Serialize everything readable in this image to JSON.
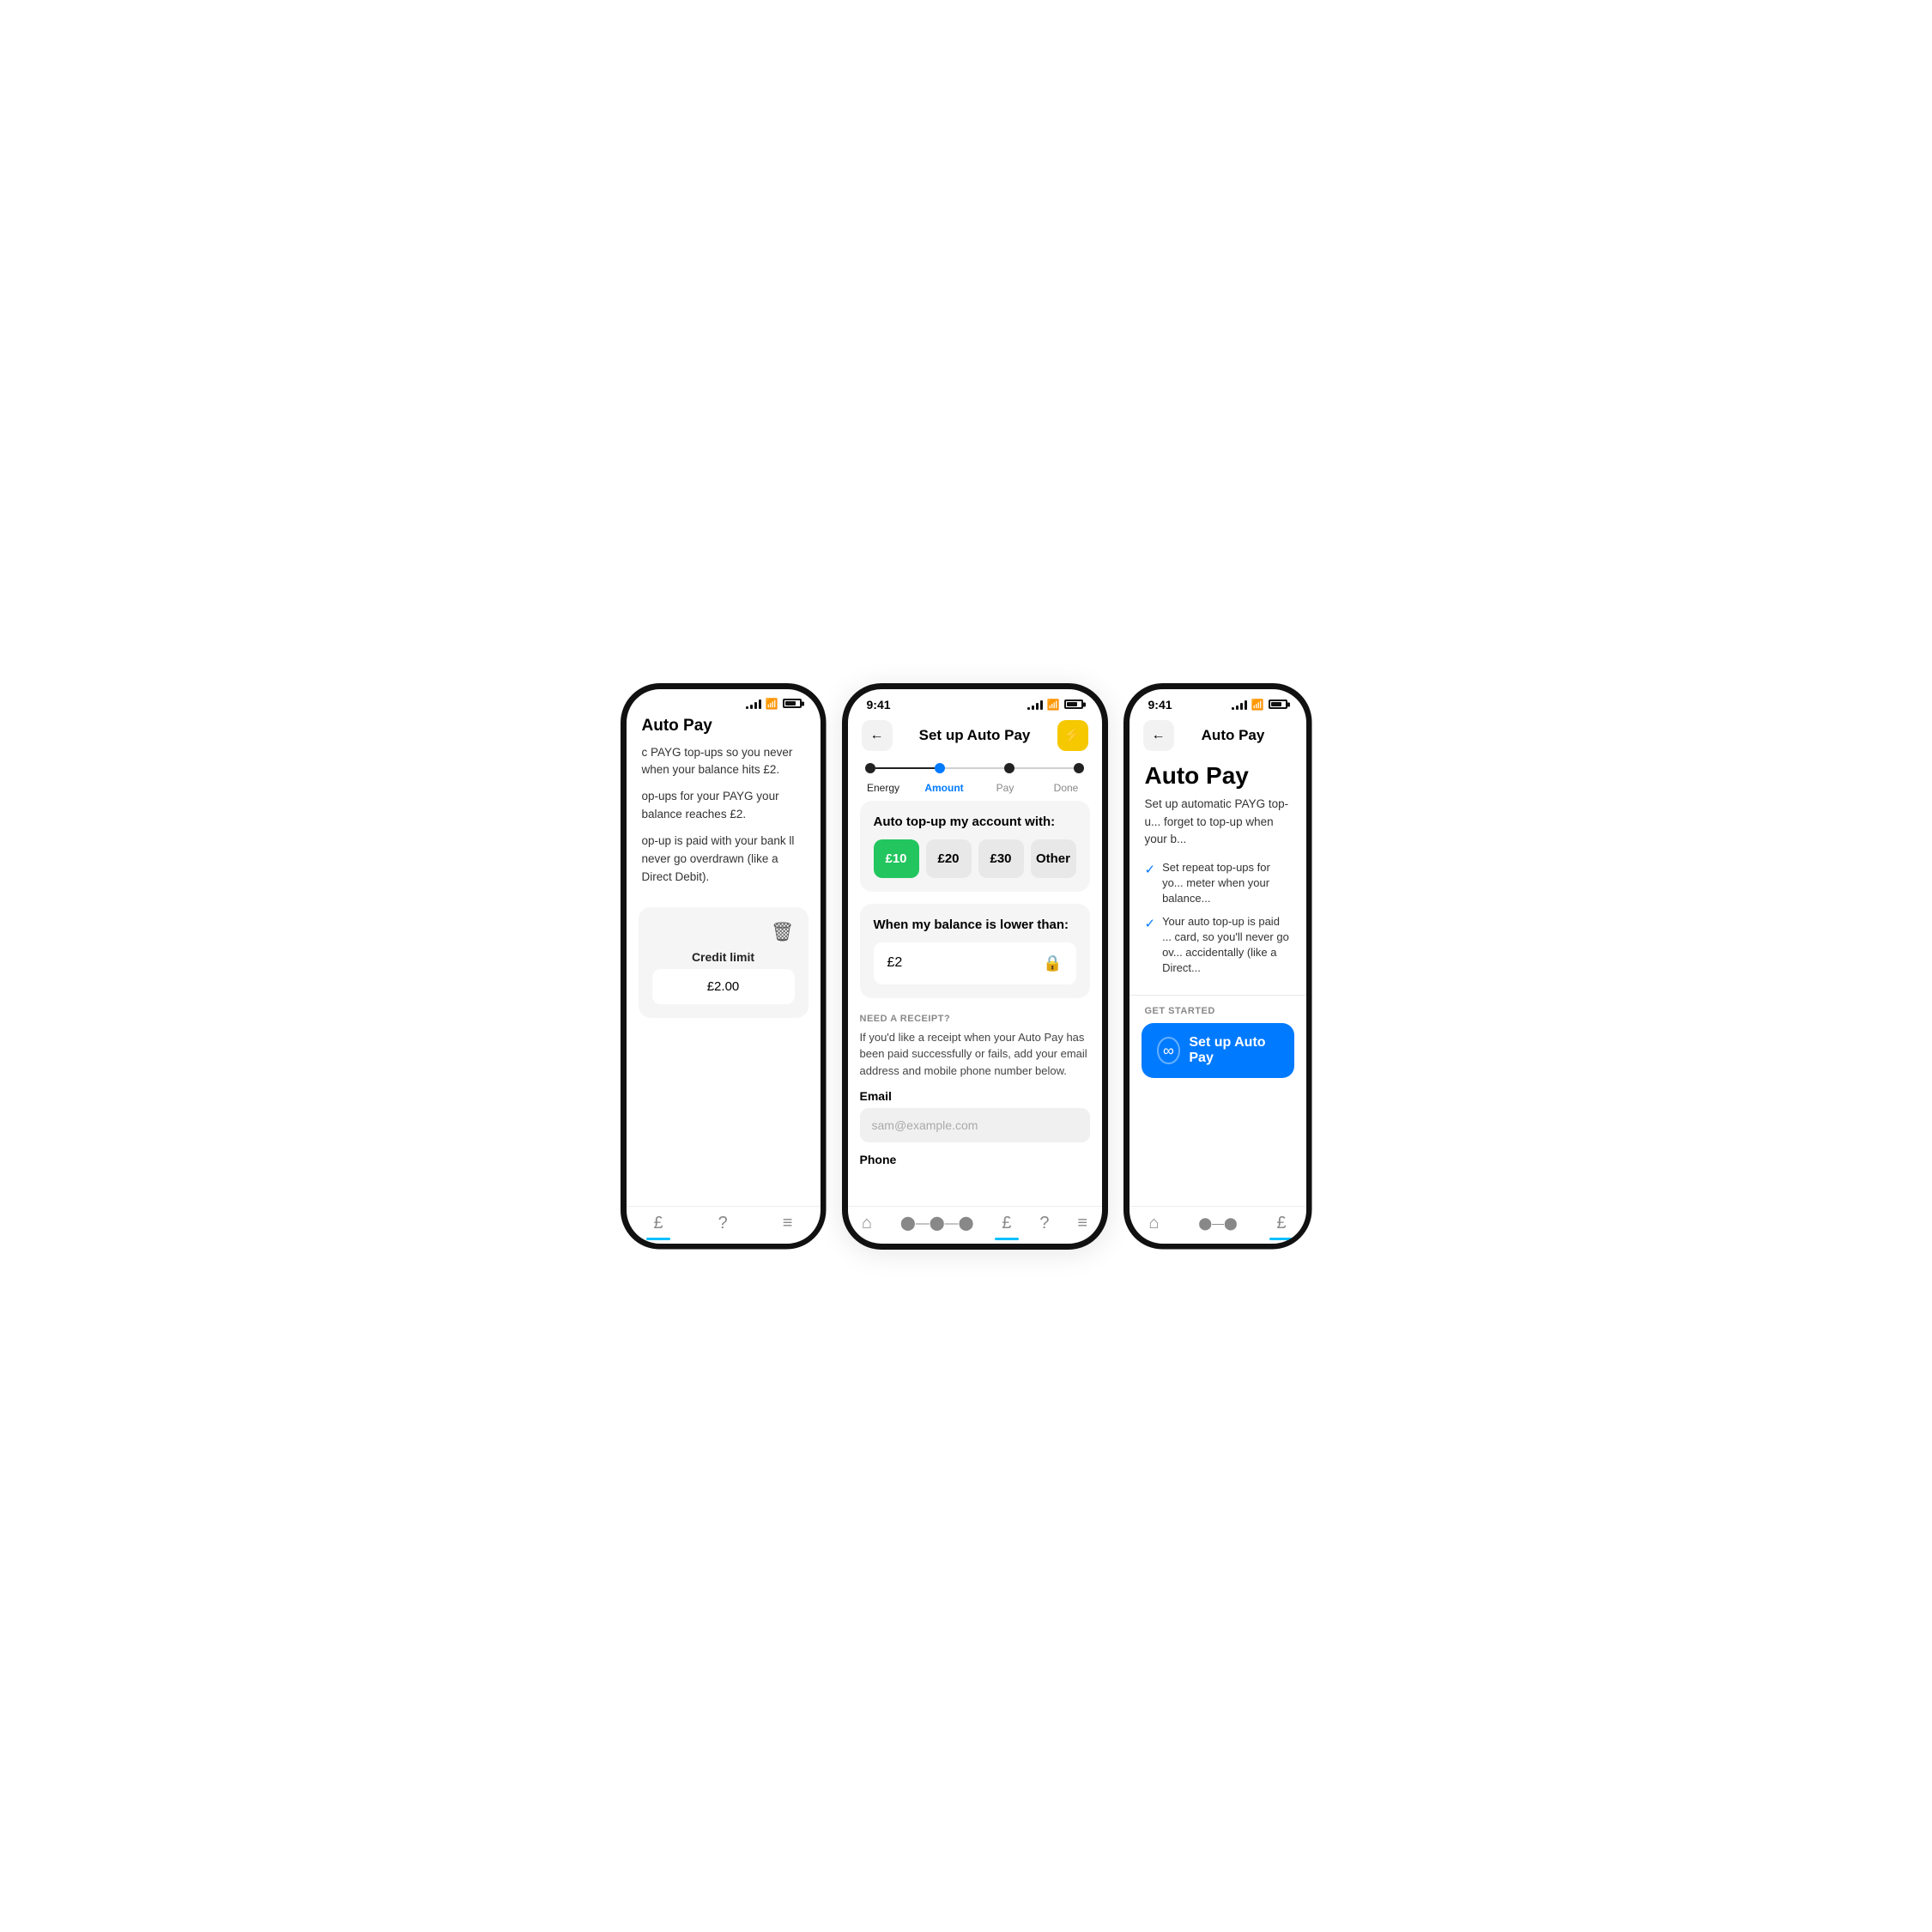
{
  "colors": {
    "accent_blue": "#007AFF",
    "accent_green": "#22c55e",
    "accent_yellow": "#f5c800",
    "tab_active": "#00c0ff"
  },
  "left_phone": {
    "title": "Auto Pay",
    "body_lines": [
      "c PAYG top-ups so you never when your balance hits £2.",
      "op-ups for your PAYG your balance reaches £2.",
      "op-up is paid with your bank ll never go overdrawn (like a Direct Debit)."
    ],
    "credit_limit": {
      "label": "Credit limit",
      "value": "£2.00"
    },
    "tabs": [
      "£",
      "?",
      "≡"
    ]
  },
  "center_phone": {
    "status": {
      "time": "9:41"
    },
    "header": {
      "back_label": "←",
      "title": "Set up Auto Pay",
      "action_icon": "⚡"
    },
    "stepper": {
      "steps": [
        "Energy",
        "Amount",
        "Pay",
        "Done"
      ],
      "active_index": 1
    },
    "amount_section": {
      "title": "Auto top-up my account with:",
      "options": [
        "£10",
        "£20",
        "£30",
        "Other"
      ],
      "selected": "£10"
    },
    "balance_section": {
      "title": "When my balance is lower than:",
      "value": "£2"
    },
    "receipt_section": {
      "label": "NEED A RECEIPT?",
      "description": "If you'd like a receipt when your Auto Pay has been paid successfully or fails, add your email address and mobile phone number below.",
      "email_label": "Email",
      "email_placeholder": "sam@example.com",
      "phone_label": "Phone"
    },
    "tabs": [
      "🏠",
      "◌◌",
      "£",
      "?",
      "≡"
    ]
  },
  "right_phone": {
    "status": {
      "time": "9:41"
    },
    "header": {
      "back_label": "←",
      "title": "Auto Pay"
    },
    "main_title": "Auto Pay",
    "subtitle": "Set up automatic PAYG top-u... forget to top-up when your b...",
    "checklist": [
      "Set repeat top-ups for yo... meter when your balance...",
      "Your auto top-up is paid ... card, so you'll never go ov... accidentally (like a Direct..."
    ],
    "get_started_label": "GET STARTED",
    "setup_btn_label": "Set up Auto Pay",
    "tabs": [
      "🏠",
      "◌◌",
      "£"
    ]
  }
}
